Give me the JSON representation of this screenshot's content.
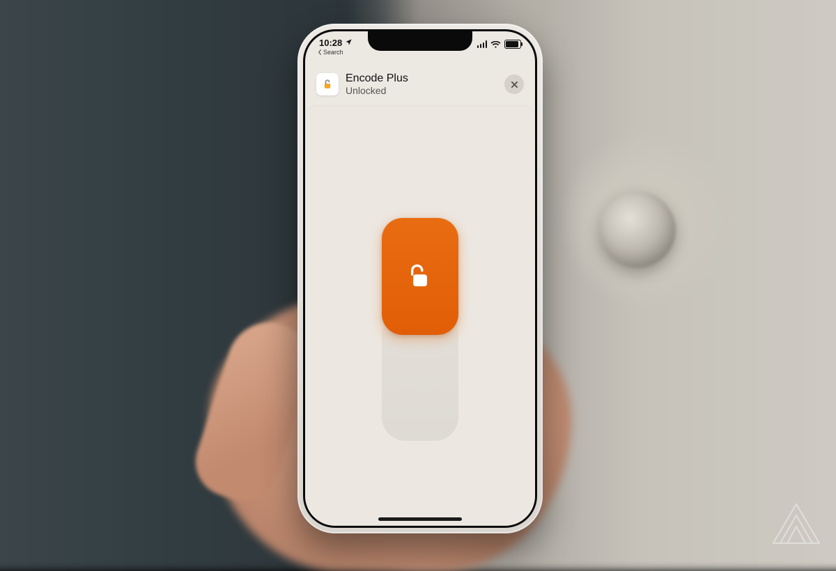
{
  "status": {
    "time": "10:28",
    "back_label": "Search"
  },
  "header": {
    "title": "Encode Plus",
    "subtitle": "Unlocked"
  },
  "colors": {
    "accent": "#e15e07"
  }
}
